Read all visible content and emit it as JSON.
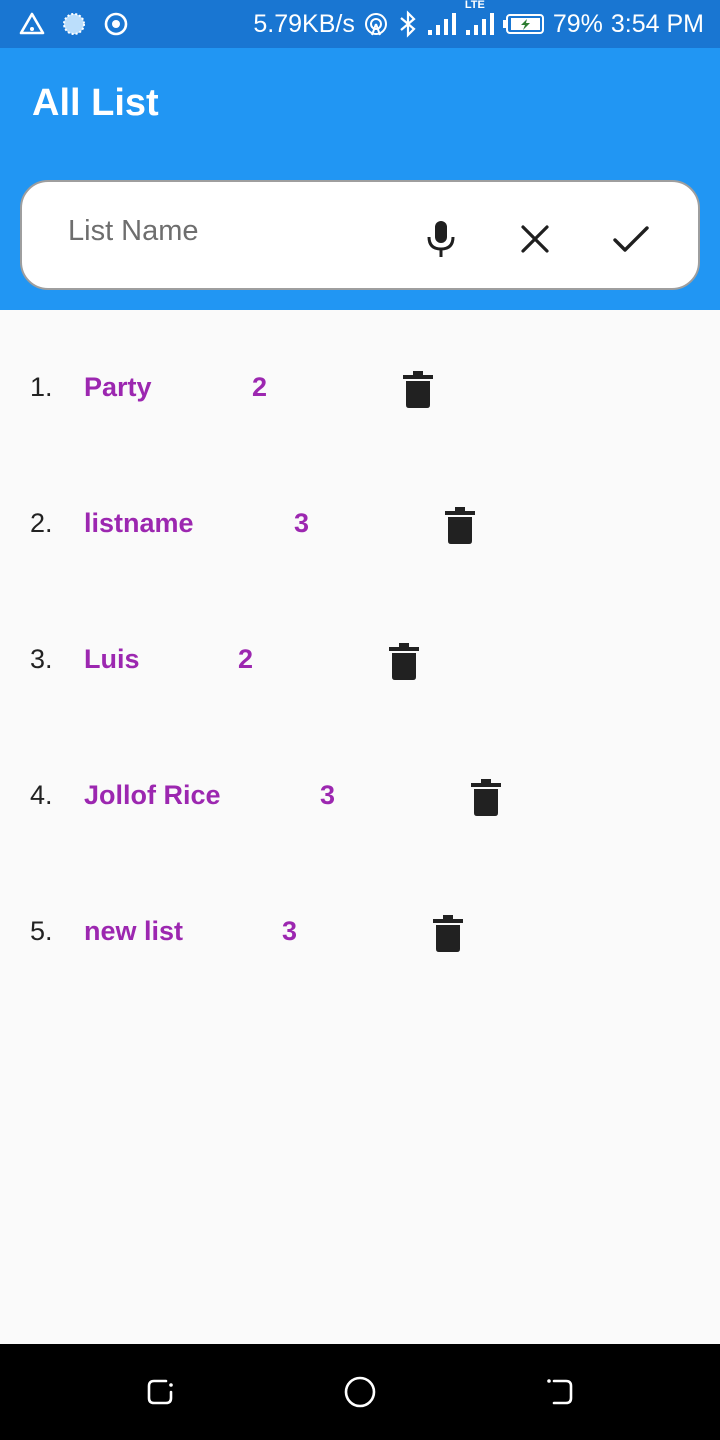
{
  "status_bar": {
    "network_speed": "5.79KB/s",
    "network_type": "LTE",
    "battery": "79%",
    "time": "3:54 PM",
    "icons": [
      "alert-triangle-icon",
      "loading-spinner-icon",
      "target-icon",
      "hotspot-icon",
      "bluetooth-icon",
      "signal-icon",
      "lte-signal-icon",
      "battery-charging-icon"
    ]
  },
  "app_bar": {
    "title": "All List"
  },
  "search": {
    "placeholder": "List Name",
    "value": "",
    "buttons": [
      "mic-icon",
      "close-icon",
      "check-icon"
    ]
  },
  "lists": [
    {
      "index": "1.",
      "name": "Party",
      "count": "2"
    },
    {
      "index": "2.",
      "name": "listname",
      "count": "3"
    },
    {
      "index": "3.",
      "name": "Luis",
      "count": "2"
    },
    {
      "index": "4.",
      "name": "Jollof Rice",
      "count": "3"
    },
    {
      "index": "5.",
      "name": "new list",
      "count": "3"
    }
  ],
  "nav_bar": {
    "buttons": [
      "recent-apps-icon",
      "home-icon",
      "back-icon"
    ]
  },
  "colors": {
    "status_bar": "#1976d2",
    "app_bar": "#2196f3",
    "accent_text": "#9c27b0",
    "background": "#fafafa"
  }
}
